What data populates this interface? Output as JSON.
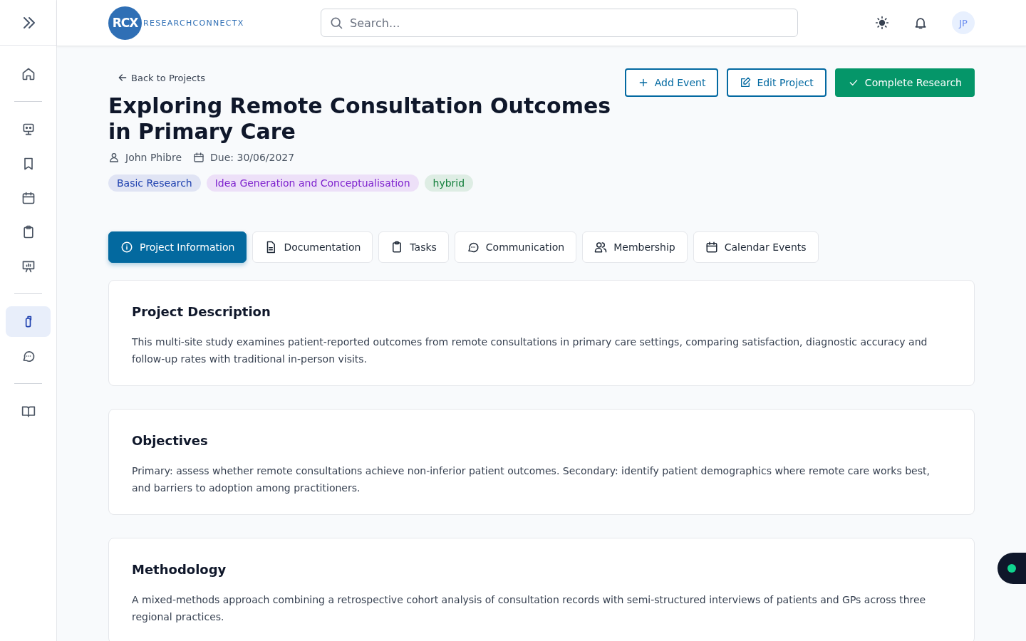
{
  "header": {
    "logo_mark": "RCX",
    "logo_text": "RESEARCHCONNECTX",
    "search": {
      "placeholder": "Search..."
    },
    "avatar": "JP"
  },
  "sidebar": {
    "groups": [
      [
        {
          "selected": false
        }
      ],
      [
        {
          "selected": false
        },
        {
          "selected": false
        },
        {
          "selected": false
        },
        {
          "selected": false
        },
        {
          "selected": false
        }
      ],
      [
        {
          "selected": true
        },
        {
          "selected": false
        }
      ],
      [
        {
          "selected": false
        }
      ]
    ]
  },
  "back_link": "Back to Projects",
  "actions": [
    {
      "label": "Add Event",
      "kind": "outline"
    },
    {
      "label": "Edit Project",
      "kind": "outline"
    },
    {
      "label": "Complete Research",
      "kind": "primary"
    }
  ],
  "project": {
    "title": "Exploring Remote Consultation Outcomes in Primary Care",
    "owner": "John Phibre",
    "due": "Due: 30/06/2027",
    "tags": [
      {
        "label": "Basic Research",
        "color": "#1e40af"
      },
      {
        "label": "Idea Generation and Conceptualisation",
        "color": "#7e22ce"
      },
      {
        "label": "hybrid",
        "color": "#15803d"
      }
    ]
  },
  "tabs": [
    {
      "label": "Project Information",
      "selected": true
    },
    {
      "label": "Documentation",
      "selected": false
    },
    {
      "label": "Tasks",
      "selected": false
    },
    {
      "label": "Communication",
      "selected": false
    },
    {
      "label": "Membership",
      "selected": false
    },
    {
      "label": "Calendar Events",
      "selected": false
    }
  ],
  "sections": [
    {
      "heading": "Project Description",
      "text": "This multi-site study examines patient-reported outcomes from remote consultations in primary care settings, comparing satisfaction, diagnostic accuracy and follow-up rates with traditional in-person visits."
    },
    {
      "heading": "Objectives",
      "text": "Primary: assess whether remote consultations achieve non-inferior patient outcomes. Secondary: identify patient demographics where remote care works best, and barriers to adoption among practitioners."
    },
    {
      "heading": "Methodology",
      "text": "A mixed-methods approach combining a retrospective cohort analysis of consultation records with semi-structured interviews of patients and GPs across three regional practices."
    }
  ]
}
